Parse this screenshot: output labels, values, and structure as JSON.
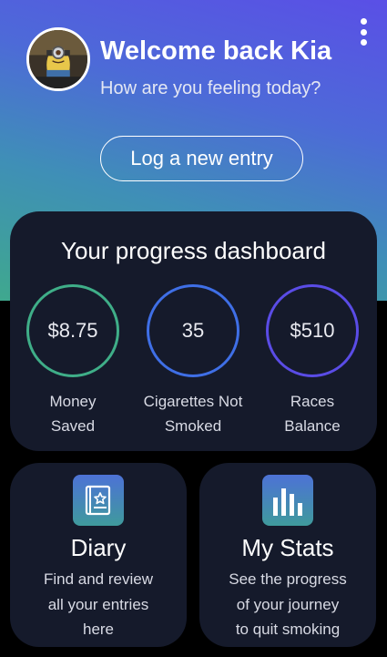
{
  "header": {
    "welcome": "Welcome back Kia",
    "subtitle": "How are you feeling today?",
    "log_button": "Log a new entry"
  },
  "icons": {
    "menu": "more-vert-icon",
    "diary": "book-star-icon",
    "stats": "bar-chart-icon"
  },
  "dashboard": {
    "title": "Your progress dashboard",
    "metrics": [
      {
        "value": "$8.75",
        "label_line1": "Money",
        "label_line2": "Saved",
        "color": "#3fae88"
      },
      {
        "value": "35",
        "label_line1": "Cigarettes Not",
        "label_line2": "Smoked",
        "color": "#3f6fe6"
      },
      {
        "value": "$510",
        "label_line1": "Races",
        "label_line2": "Balance",
        "color": "#5a4ce6"
      }
    ]
  },
  "tiles": {
    "diary": {
      "title": "Diary",
      "desc_line1": "Find and review",
      "desc_line2": "all your entries",
      "desc_line3": "here"
    },
    "stats": {
      "title": "My Stats",
      "desc_line1": "See the progress",
      "desc_line2": "of your journey",
      "desc_line3": "to quit smoking"
    }
  },
  "colors": {
    "gradient_top": "#5a4fe6",
    "gradient_bottom": "#3fa88e",
    "card_bg": "#151a2b",
    "page_bg": "#000000"
  }
}
